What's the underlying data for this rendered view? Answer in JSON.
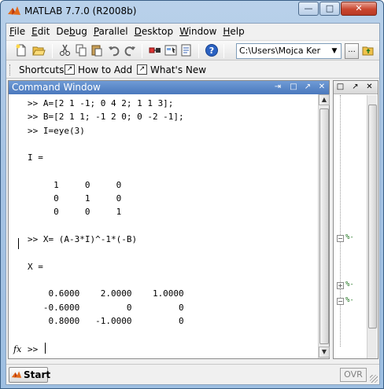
{
  "window": {
    "title": "MATLAB  7.7.0 (R2008b)",
    "minimize_glyph": "—",
    "maximize_glyph": "□",
    "close_glyph": "✕"
  },
  "menu": [
    "File",
    "Edit",
    "Debug",
    "Parallel",
    "Desktop",
    "Window",
    "Help"
  ],
  "menu_underline": [
    "F",
    "E",
    "b",
    "P",
    "D",
    "W",
    "H"
  ],
  "toolbar": {
    "current_folder": "C:\\Users\\Mojca Ker",
    "browse_label": "...",
    "icons": [
      "new-file-icon",
      "open-folder-icon",
      "cut-icon",
      "copy-icon",
      "paste-icon",
      "undo-icon",
      "redo-icon",
      "simulink-icon",
      "guide-icon",
      "profiler-icon",
      "help-icon",
      "up-folder-icon"
    ]
  },
  "shortcuts": {
    "label": "Shortcuts",
    "how_to_add": "How to Add",
    "whats_new": "What's New"
  },
  "command_window": {
    "title": "Command Window",
    "lines": [
      ">> A=[2 1 -1; 0 4 2; 1 1 3];",
      ">> B=[2 1 1; -1 2 0; 0 -2 -1];",
      ">> I=eye(3)",
      "",
      "I =",
      "",
      "     1     0     0",
      "     0     1     0",
      "     0     0     1",
      "",
      ">> X= (A-3*I)^-1*(-B)",
      "",
      "X =",
      "",
      "    0.6000    2.0000    1.0000",
      "   -0.6000         0         0",
      "    0.8000   -1.0000         0"
    ],
    "prompt": ">>",
    "fx_label": "fx"
  },
  "status": {
    "start_label": "Start",
    "ovr_label": "OVR"
  },
  "colors": {
    "title_gradient_top": "#b9d1ea",
    "cmd_header": "#4a78bd",
    "workspace_green": "#2a7a2a"
  }
}
